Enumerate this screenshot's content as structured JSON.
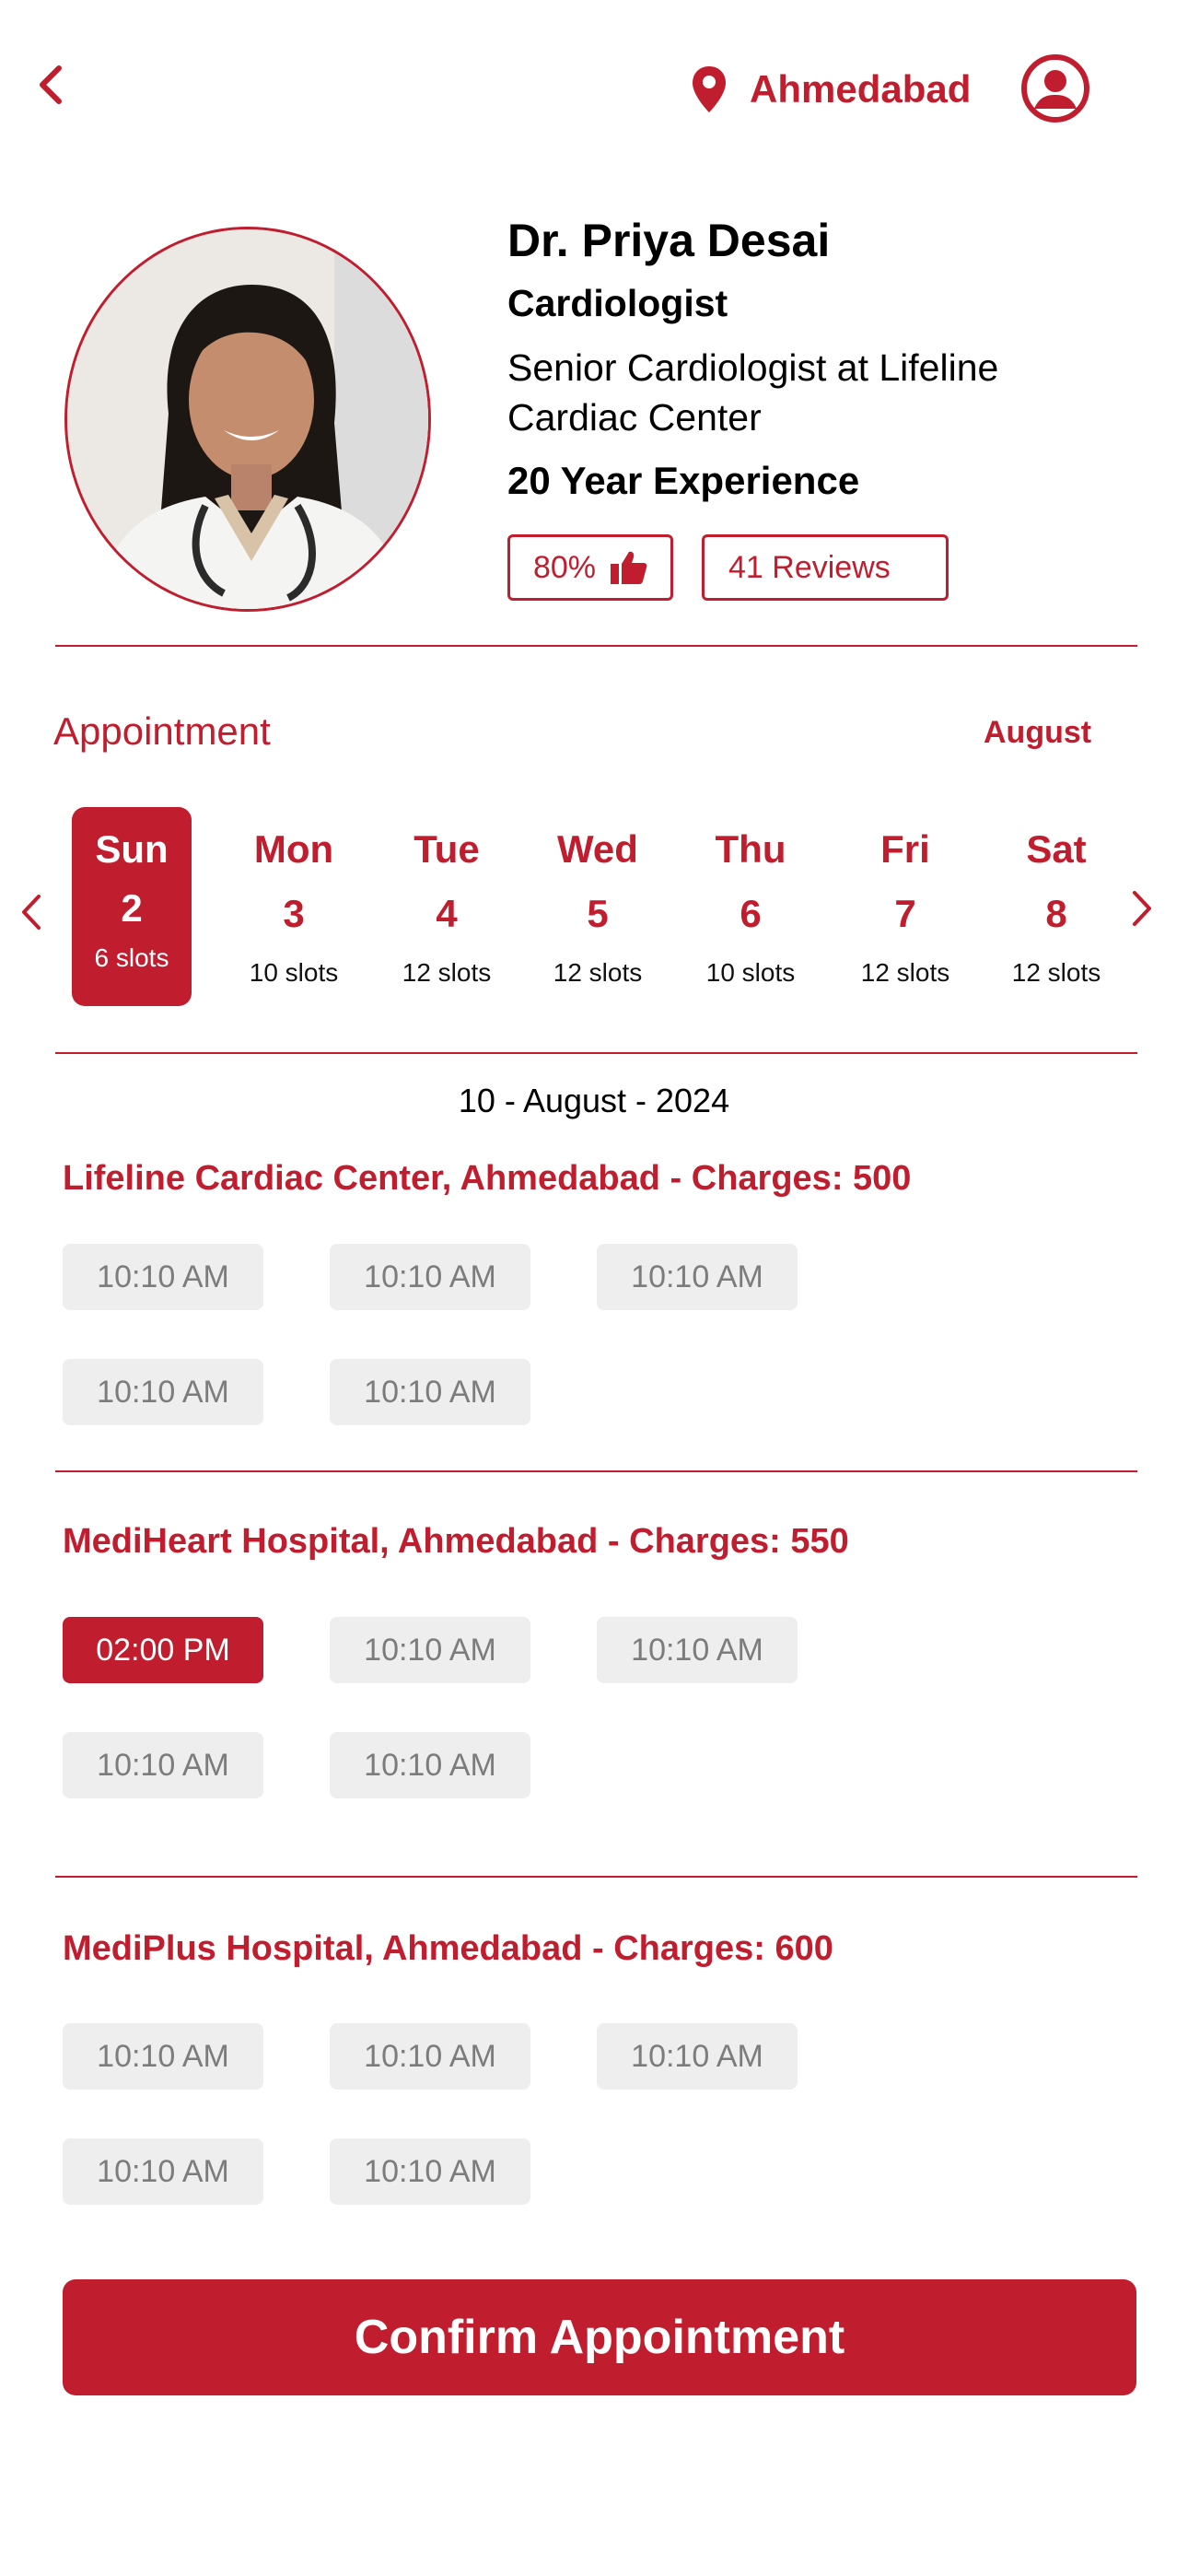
{
  "header": {
    "back_icon": "chevron-left-icon",
    "location_icon": "map-pin-icon",
    "location": "Ahmedabad",
    "profile_icon": "user-circle-icon"
  },
  "doctor": {
    "name": "Dr. Priya Desai",
    "specialty": "Cardiologist",
    "description": "Senior Cardiologist at Lifeline Cardiac Center",
    "experience": "20 Year Experience",
    "rating": "80%",
    "rating_icon": "thumbs-up-icon",
    "reviews": "41 Reviews"
  },
  "appointment": {
    "title": "Appointment",
    "month": "August",
    "prev_icon": "chevron-left-icon",
    "next_icon": "chevron-right-icon",
    "days": [
      {
        "name": "Sun",
        "date": "2",
        "slots": "6 slots",
        "active": true
      },
      {
        "name": "Mon",
        "date": "3",
        "slots": "10 slots"
      },
      {
        "name": "Tue",
        "date": "4",
        "slots": "12 slots"
      },
      {
        "name": "Wed",
        "date": "5",
        "slots": "12 slots"
      },
      {
        "name": "Thu",
        "date": "6",
        "slots": "10 slots"
      },
      {
        "name": "Fri",
        "date": "7",
        "slots": "12 slots"
      },
      {
        "name": "Sat",
        "date": "8",
        "slots": "12 slots"
      }
    ],
    "selected_date": "10 - August - 2024"
  },
  "clinics": [
    {
      "title": "Lifeline Cardiac Center, Ahmedabad - Charges: 500",
      "slots": [
        "10:10 AM",
        "10:10 AM",
        "10:10 AM",
        "10:10 AM",
        "10:10 AM"
      ]
    },
    {
      "title": "MediHeart Hospital, Ahmedabad - Charges: 550",
      "slots": [
        "02:00 PM",
        "10:10 AM",
        "10:10 AM",
        "10:10 AM",
        "10:10 AM"
      ],
      "selected_index": 0
    },
    {
      "title": "MediPlus Hospital, Ahmedabad - Charges: 600",
      "slots": [
        "10:10 AM",
        "10:10 AM",
        "10:10 AM",
        "10:10 AM",
        "10:10 AM"
      ]
    }
  ],
  "confirm_label": "Confirm Appointment",
  "colors": {
    "accent": "#C01E2E",
    "slot_bg": "#EEEEEE",
    "slot_text": "#7c7c7c"
  }
}
